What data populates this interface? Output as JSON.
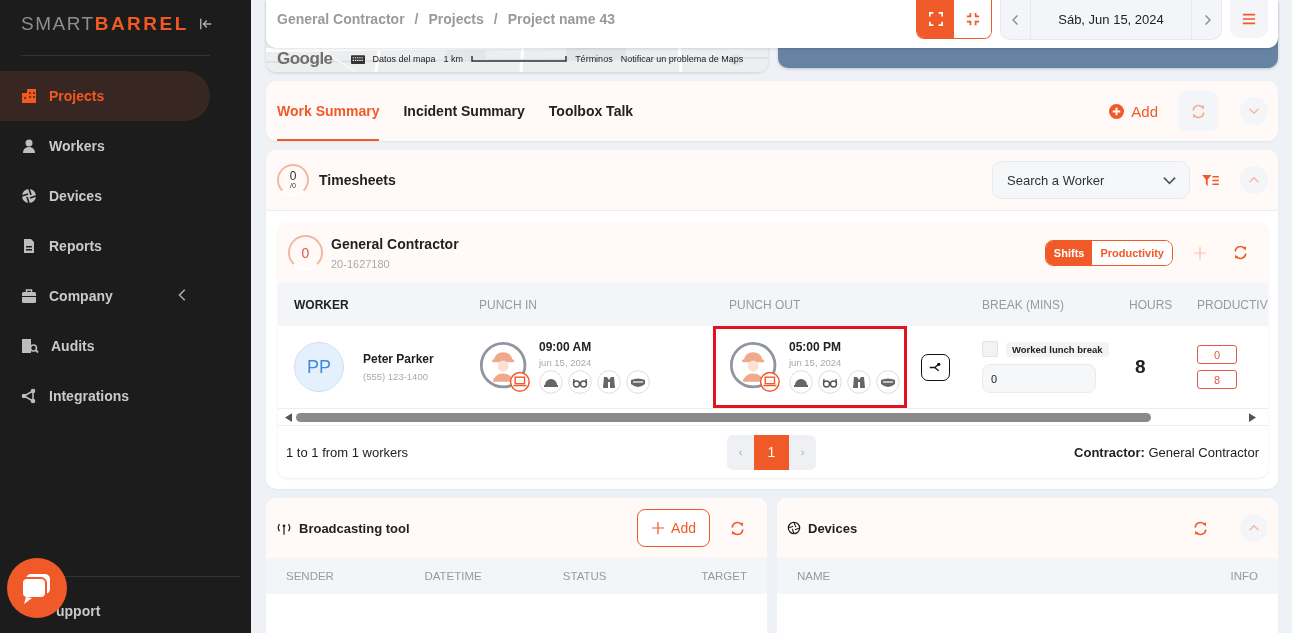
{
  "sidebar": {
    "logo": {
      "light": "SMART",
      "bold": "BARREL"
    },
    "items": [
      {
        "label": "Projects",
        "kind": "projects",
        "selected": true
      },
      {
        "label": "Workers",
        "kind": "workers",
        "selected": false
      },
      {
        "label": "Devices",
        "kind": "devices",
        "selected": false
      },
      {
        "label": "Reports",
        "kind": "reports",
        "selected": false
      },
      {
        "label": "Company",
        "kind": "company",
        "selected": false,
        "submenu": true
      },
      {
        "label": "Audits",
        "kind": "audits",
        "selected": false
      },
      {
        "label": "Integrations",
        "kind": "integrations",
        "selected": false
      }
    ],
    "support": "upport"
  },
  "header": {
    "breadcrumb": [
      "General Contractor",
      "Projects",
      "Project name 43"
    ],
    "separator": "/",
    "view_modes": [
      {
        "kind": "expand",
        "selected": true
      },
      {
        "kind": "compress",
        "selected": false
      }
    ],
    "date": "Sáb, Jun 15, 2024"
  },
  "map": {
    "logo": "Google",
    "attribution": [
      "Datos del mapa",
      "1 km",
      "Términos",
      "Notificar un problema de Maps"
    ]
  },
  "tabs": [
    {
      "label": "Work Summary",
      "selected": true
    },
    {
      "label": "Incident Summary",
      "selected": false
    },
    {
      "label": "Toolbox Talk",
      "selected": false
    }
  ],
  "tab_actions": {
    "add": "Add"
  },
  "timesheets": {
    "count": "0",
    "total": "/0",
    "title": "Timesheets",
    "search": {
      "placeholder": "Search a Worker"
    },
    "contractor": {
      "count": "0",
      "name": "General Contractor",
      "id": "20-1627180",
      "modes": [
        {
          "label": "Shifts",
          "selected": true
        },
        {
          "label": "Productivity",
          "selected": false
        }
      ],
      "columns": [
        "WORKER",
        "PUNCH IN",
        "PUNCH OUT",
        "BREAK (MINS)",
        "HOURS",
        "PRODUCTIV"
      ],
      "rows": [
        {
          "initials": "PP",
          "name": "Peter Parker",
          "phone": "(555) 123-1400",
          "punch_in": {
            "time": "09:00 AM",
            "date": "jun 15, 2024"
          },
          "punch_out": {
            "time": "05:00 PM",
            "date": "jun 15, 2024",
            "highlighted": true
          },
          "break": {
            "worked_lunch": false,
            "label": "Worked lunch break",
            "value": "0"
          },
          "hours": "8",
          "productivity": [
            "0",
            "8"
          ]
        }
      ],
      "summary": "1 to 1 from 1 workers",
      "pager": {
        "prev": "‹",
        "next": "›",
        "pages": [
          {
            "label": "1",
            "selected": true
          }
        ]
      },
      "footer_note": "**Contractor:** General Contractor"
    }
  },
  "broadcasting": {
    "title": "Broadcasting tool",
    "add": "Add",
    "columns": [
      "SENDER",
      "DATETIME",
      "STATUS",
      "TARGET"
    ]
  },
  "devices": {
    "title": "Devices",
    "columns": [
      "NAME",
      "INFO"
    ]
  }
}
